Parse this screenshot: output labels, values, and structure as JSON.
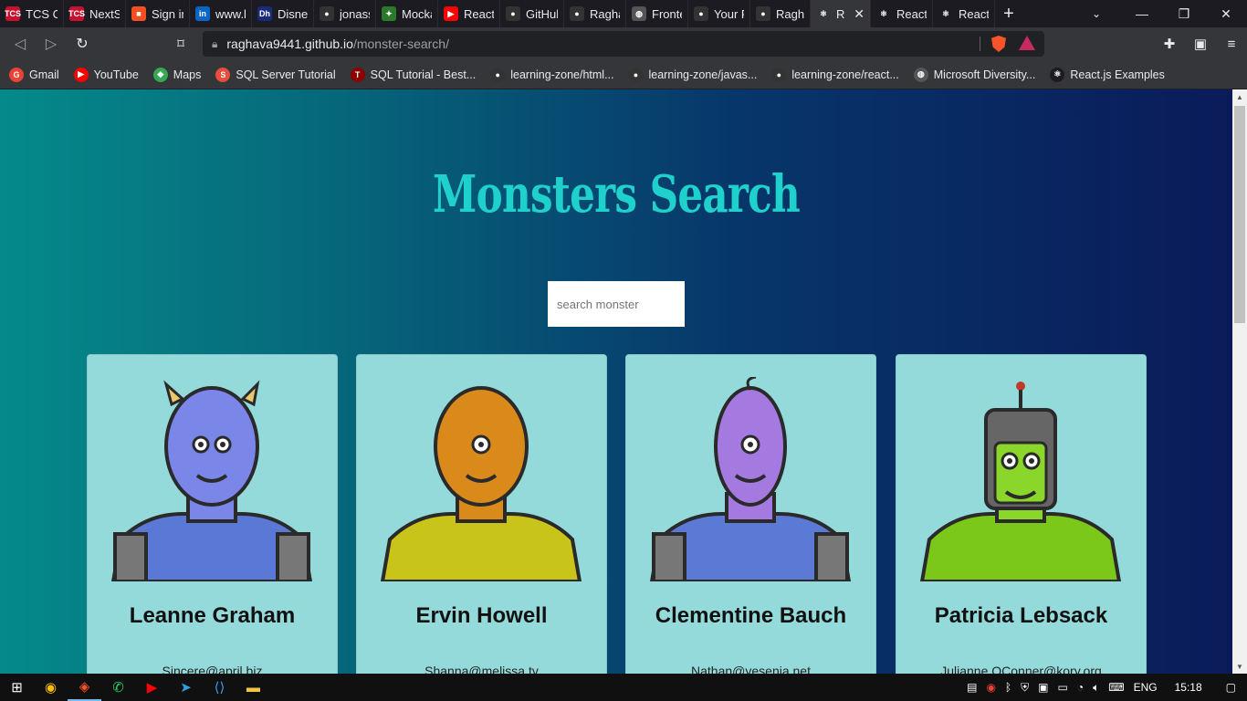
{
  "browser": {
    "tabs": [
      {
        "title": "TCS C",
        "icon": "tcs-icon",
        "color": "#c41230",
        "glyph": "TCS"
      },
      {
        "title": "NextS",
        "icon": "tcs-icon",
        "color": "#c41230",
        "glyph": "TCS"
      },
      {
        "title": "Sign in",
        "icon": "microsoft-icon",
        "color": "#f25022",
        "glyph": "■"
      },
      {
        "title": "www.li",
        "icon": "linkedin-icon",
        "color": "#0a66c2",
        "glyph": "in"
      },
      {
        "title": "Disney",
        "icon": "disney-icon",
        "color": "#1a2b7a",
        "glyph": "Dh"
      },
      {
        "title": "jonass",
        "icon": "github-icon",
        "color": "#333333",
        "glyph": "●"
      },
      {
        "title": "Mocka",
        "icon": "mockaroo-icon",
        "color": "#2b7a2b",
        "glyph": "✦"
      },
      {
        "title": "React",
        "icon": "youtube-icon",
        "color": "#ff0000",
        "glyph": "▶"
      },
      {
        "title": "GitHub",
        "icon": "github-icon",
        "color": "#333333",
        "glyph": "●"
      },
      {
        "title": "Ragha",
        "icon": "github-icon",
        "color": "#333333",
        "glyph": "●"
      },
      {
        "title": "Fronte",
        "icon": "globe-icon",
        "color": "#555555",
        "glyph": "◍"
      },
      {
        "title": "Your F",
        "icon": "github-icon",
        "color": "#333333",
        "glyph": "●"
      },
      {
        "title": "Ragha",
        "icon": "github-icon",
        "color": "#333333",
        "glyph": "●"
      },
      {
        "title": "Re",
        "icon": "react-icon",
        "color": "#35363a",
        "glyph": "⚛",
        "active": true
      },
      {
        "title": "React",
        "icon": "react-icon",
        "color": "#1c1b22",
        "glyph": "⚛"
      },
      {
        "title": "React",
        "icon": "react-icon",
        "color": "#1c1b22",
        "glyph": "⚛"
      }
    ],
    "url_host": "raghava9441.github.io",
    "url_path": "/monster-search/",
    "bookmarks": [
      {
        "label": "Gmail",
        "icon": "google-icon",
        "color": "#ea4335",
        "glyph": "G"
      },
      {
        "label": "YouTube",
        "icon": "youtube-icon",
        "color": "#ff0000",
        "glyph": "▶"
      },
      {
        "label": "Maps",
        "icon": "maps-icon",
        "color": "#34a853",
        "glyph": "◆"
      },
      {
        "label": "SQL Server Tutorial",
        "icon": "sqlserver-icon",
        "color": "#e74c3c",
        "glyph": "S"
      },
      {
        "label": "SQL Tutorial - Best...",
        "icon": "tutorial-icon",
        "color": "#8b0000",
        "glyph": "T"
      },
      {
        "label": "learning-zone/html...",
        "icon": "github-icon",
        "color": "#333333",
        "glyph": "●"
      },
      {
        "label": "learning-zone/javas...",
        "icon": "github-icon",
        "color": "#333333",
        "glyph": "●"
      },
      {
        "label": "learning-zone/react...",
        "icon": "github-icon",
        "color": "#333333",
        "glyph": "●"
      },
      {
        "label": "Microsoft Diversity...",
        "icon": "globe-icon",
        "color": "#555555",
        "glyph": "◍"
      },
      {
        "label": "React.js Examples",
        "icon": "react-icon",
        "color": "#1c1b22",
        "glyph": "⚛"
      }
    ]
  },
  "app": {
    "title": "Monsters Search",
    "search_placeholder": "search monster",
    "monsters": [
      {
        "name": "Leanne Graham",
        "email": "Sincere@april.biz",
        "skin": "#7a86e8",
        "body": "#5a78d6",
        "accent": "#e8c86a"
      },
      {
        "name": "Ervin Howell",
        "email": "Shanna@melissa.tv",
        "skin": "#d98a1a",
        "body": "#c8c41a",
        "accent": "#8aa82a"
      },
      {
        "name": "Clementine Bauch",
        "email": "Nathan@yesenia.net",
        "skin": "#a47ae0",
        "body": "#5a7ad6",
        "accent": "#888888"
      },
      {
        "name": "Patricia Lebsack",
        "email": "Julianne.OConner@kory.org",
        "skin": "#8ad62a",
        "body": "#7cc81a",
        "accent": "#888888"
      }
    ]
  },
  "taskbar": {
    "lang": "ENG",
    "time": "15:18"
  }
}
